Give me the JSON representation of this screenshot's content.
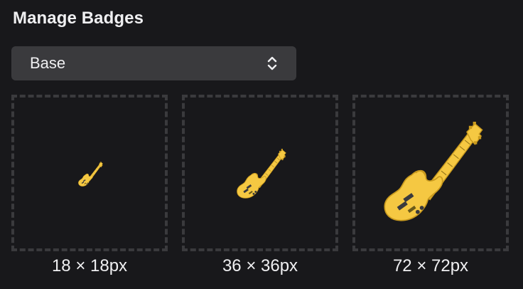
{
  "header": {
    "title": "Manage Badges"
  },
  "badge_type_select": {
    "value": "Base",
    "icon": "chevron-up-down-icon"
  },
  "badge_sizes": [
    {
      "label": "18 × 18px",
      "icon": "guitar-icon"
    },
    {
      "label": "36 × 36px",
      "icon": "guitar-icon"
    },
    {
      "label": "72 × 72px",
      "icon": "guitar-icon"
    }
  ],
  "colors": {
    "background": "#18181b",
    "select_background": "#3a3a3d",
    "tile_border": "#3a3a3d",
    "text": "#efeff1",
    "guitar_body": "#f5c842",
    "guitar_shadow": "#c99a1e",
    "guitar_neck_lines": "#9a7a1a"
  }
}
